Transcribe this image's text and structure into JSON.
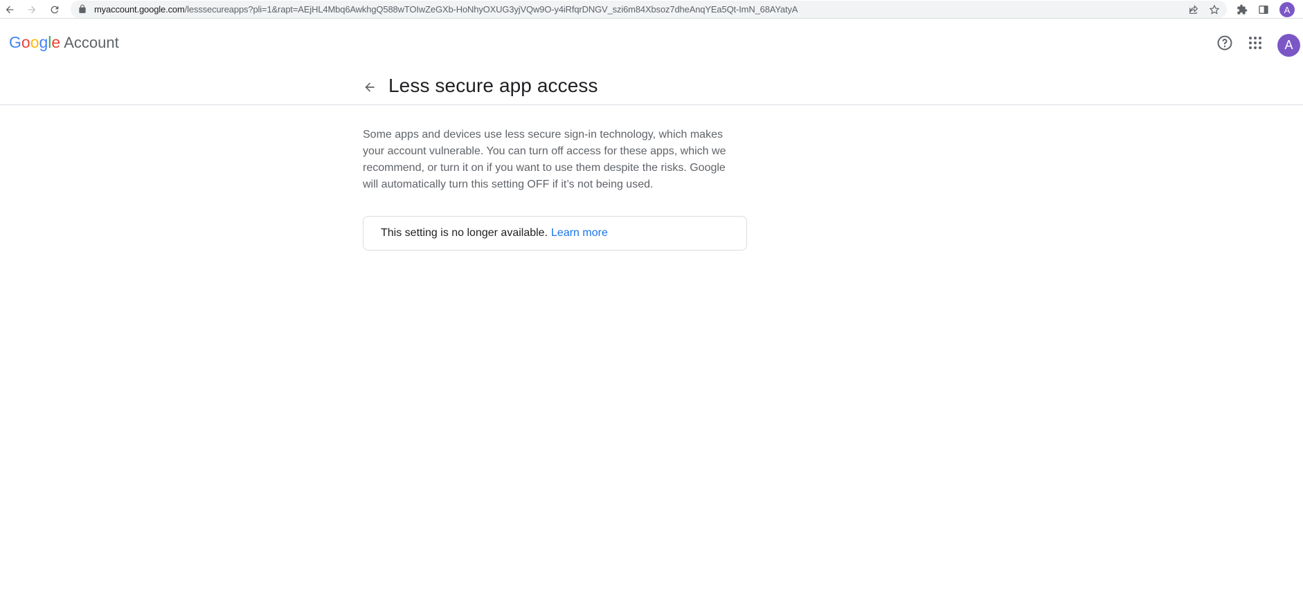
{
  "browser": {
    "url_host": "myaccount.google.com",
    "url_path": "/lesssecureapps?pli=1&rapt=AEjHL4Mbq6AwkhgQ588wTOIwZeGXb-HoNhyOXUG3yjVQw9O-y4iRfqrDNGV_szi6m84Xbsoz7dheAnqYEa5Qt-ImN_68AYatyA",
    "profile_initial": "A"
  },
  "header": {
    "logo_letters": [
      "G",
      "o",
      "o",
      "g",
      "l",
      "e"
    ],
    "logo_colors": [
      "#4285F4",
      "#EA4335",
      "#FBBC05",
      "#4285F4",
      "#34A853",
      "#EA4335"
    ],
    "logo_word": "Account",
    "avatar_initial": "A",
    "avatar_color": "#7b57c6"
  },
  "page": {
    "title": "Less secure app access",
    "description": "Some apps and devices use less secure sign-in technology, which makes your account vulnerable. You can turn off access for these apps, which we recommend, or turn it on if you want to use them despite the risks. Google will automatically turn this setting OFF if it’s not being used.",
    "notice_text": "This setting is no longer available.",
    "learn_more_label": "Learn more",
    "link_color": "#1a73e8"
  },
  "icons": {
    "back": "arrow-left-icon",
    "help": "help-circle-icon",
    "apps": "apps-grid-icon"
  }
}
